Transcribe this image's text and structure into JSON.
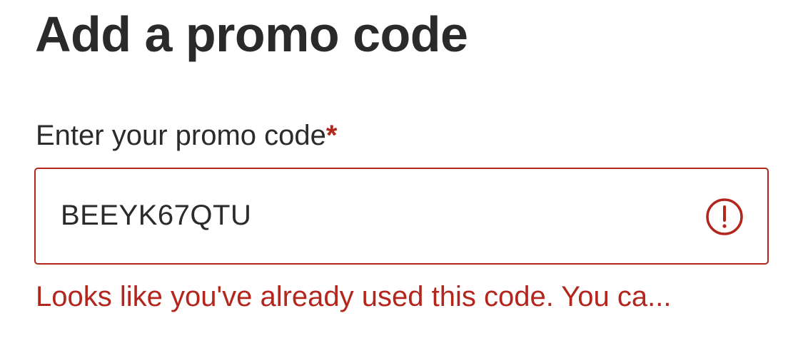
{
  "page": {
    "title": "Add a promo code"
  },
  "promo_field": {
    "label": "Enter your promo code",
    "required_marker": "*",
    "value": "BEEYK67QTU",
    "status_icon": "alert-circle-icon",
    "error_text": "Looks like you've already used this code. You ca..."
  },
  "colors": {
    "error": "#b3261e",
    "text": "#2b2b2b",
    "background": "#ffffff"
  }
}
